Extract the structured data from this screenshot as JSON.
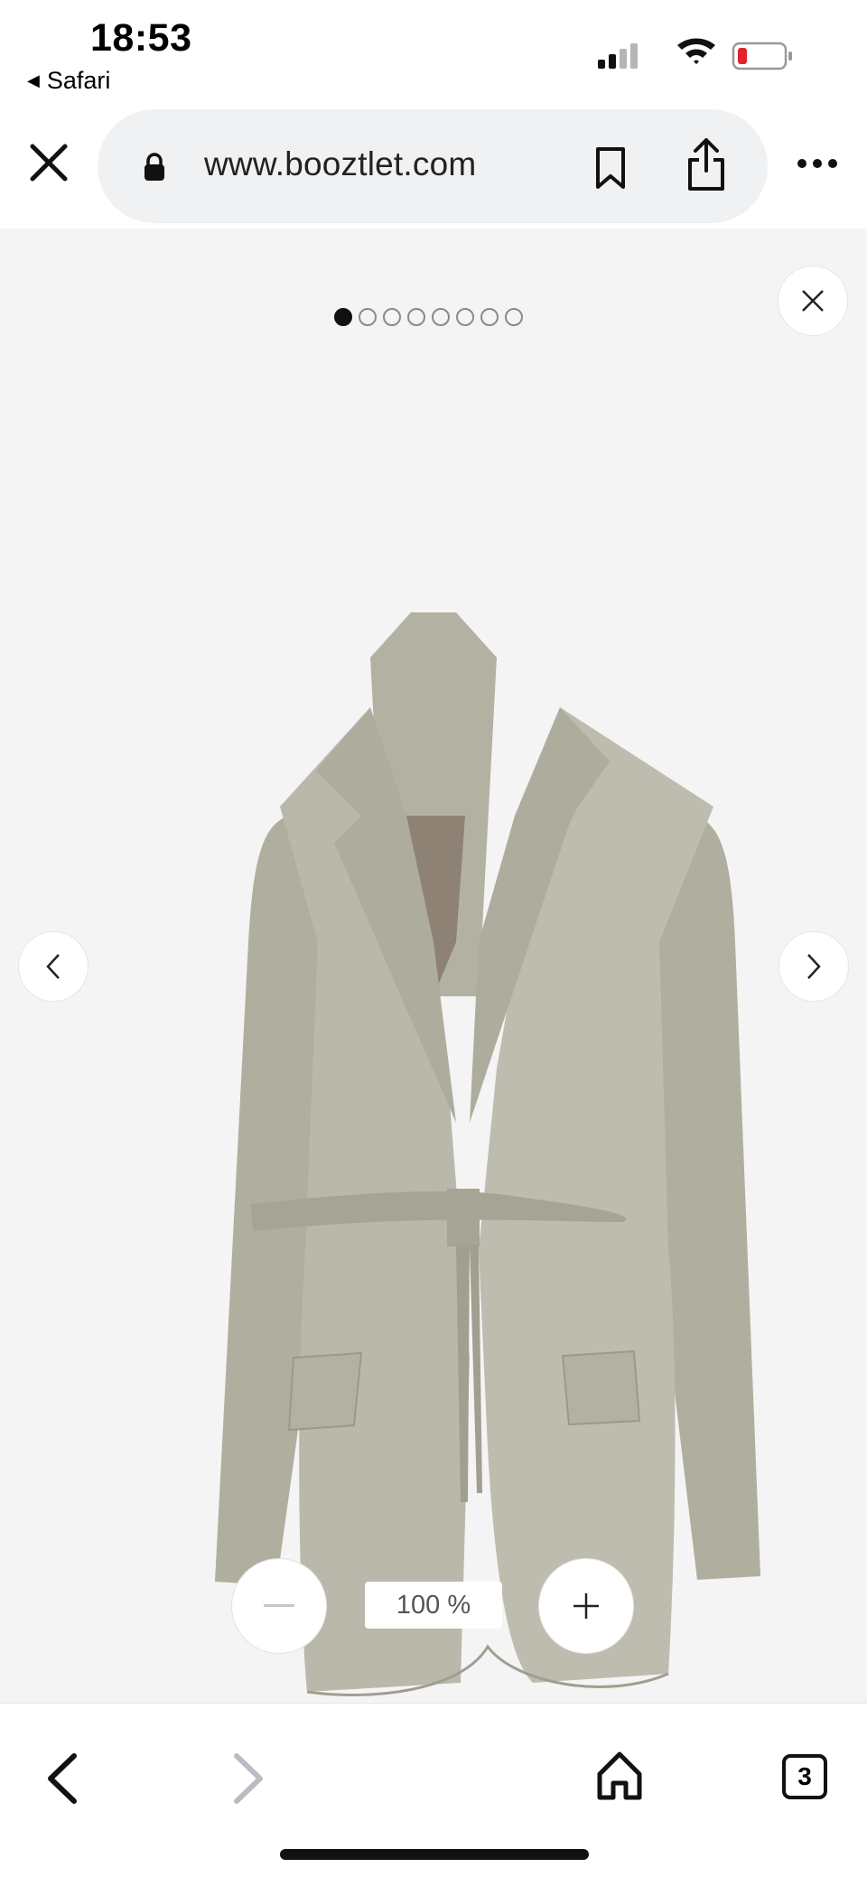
{
  "status_bar": {
    "time": "18:53",
    "back_app": "Safari",
    "back_arrow": "◀"
  },
  "browser": {
    "url": "www.booztlet.com",
    "icons": [
      "close-icon",
      "lock-icon",
      "bookmark-icon",
      "share-icon",
      "more-icon"
    ]
  },
  "gallery": {
    "image_count": 8,
    "active_index": 0,
    "zoom_label": "100 %",
    "image_subject": "blazer-image",
    "colors": {
      "background": "#f4f4f4",
      "blazer": "#b9b8aa"
    }
  },
  "toolbar": {
    "tab_count": "3"
  }
}
